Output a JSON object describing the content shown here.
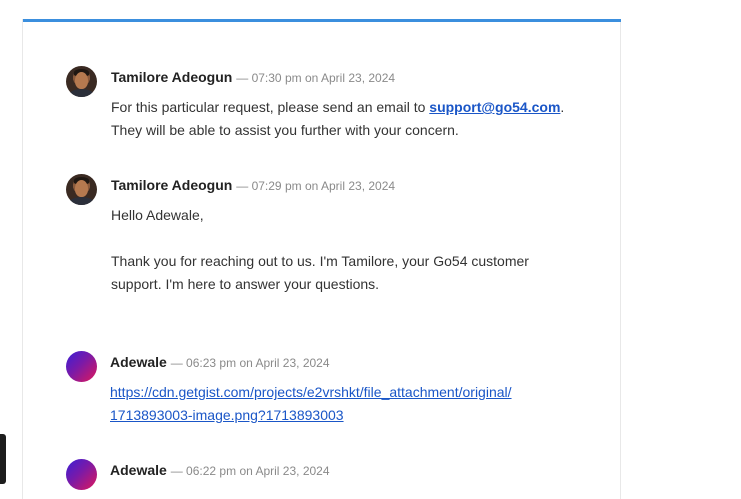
{
  "messages": [
    {
      "author": "Tamilore Adeogun",
      "time": "07:30 pm",
      "on_label": "on",
      "date": "April 23, 2024",
      "avatar": "person-photo",
      "text_before": "For this particular request, please send an email to ",
      "email": "support@go54.com",
      "text_after": ".",
      "line2": "They will be able to assist you further with your concern."
    },
    {
      "author": "Tamilore Adeogun",
      "time": "07:29 pm",
      "on_label": "on",
      "date": "April 23, 2024",
      "avatar": "person-photo",
      "greeting": "Hello Adewale,",
      "para1": "Thank you for reaching out to us. I'm Tamilore, your Go54 customer",
      "para2": "support. I'm here to answer your questions."
    },
    {
      "author": "Adewale",
      "time": "06:23 pm",
      "on_label": "on",
      "date": "April 23, 2024",
      "avatar": "gradient-circle",
      "link_line1": "https://cdn.getgist.com/projects/e2vrshkt/file_attachment/original/",
      "link_line2": "1713893003-image.png?1713893003"
    },
    {
      "author": "Adewale",
      "time": "06:22 pm",
      "on_label": "on",
      "date": "April 23, 2024",
      "avatar": "gradient-circle"
    }
  ],
  "colors": {
    "accent_bar": "#3b8fde",
    "link": "#1a56c7",
    "meta": "#8a8a8a"
  }
}
